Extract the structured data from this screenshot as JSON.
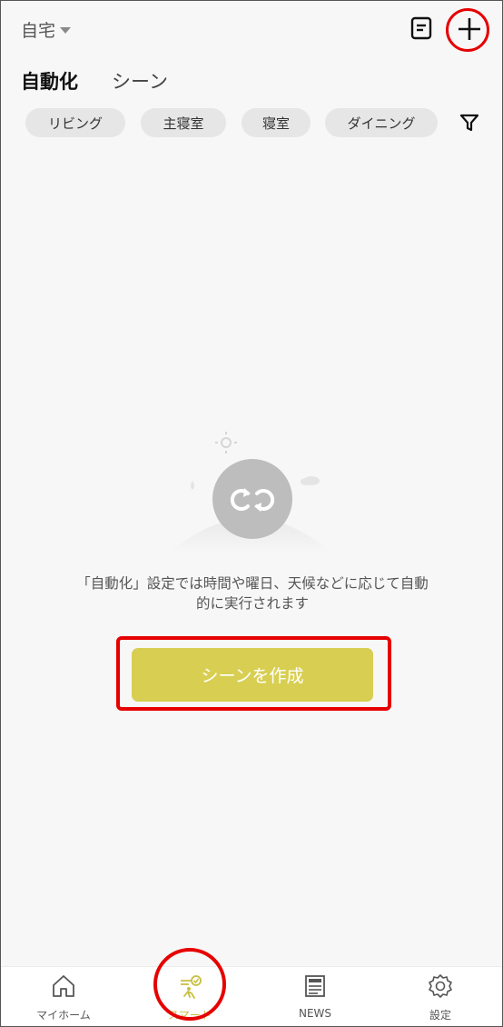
{
  "header": {
    "home_name": "自宅"
  },
  "tabs": [
    {
      "label": "自動化",
      "active": true
    },
    {
      "label": "シーン",
      "active": false
    }
  ],
  "rooms": [
    "リビング",
    "主寝室",
    "寝室",
    "ダイニング"
  ],
  "empty_state": {
    "message_line1": "「自動化」設定では時間や曜日、天候などに応じて自動",
    "message_line2": "的に実行されます",
    "create_button": "シーンを作成"
  },
  "bottom_nav": [
    {
      "label": "マイホーム",
      "icon": "home-icon",
      "active": false
    },
    {
      "label": "スマート",
      "icon": "smart-icon",
      "active": true
    },
    {
      "label": "NEWS",
      "icon": "news-icon",
      "active": false
    },
    {
      "label": "設定",
      "icon": "gear-icon",
      "active": false
    }
  ],
  "colors": {
    "accent": "#d8cf52",
    "annotation": "#e60000"
  }
}
